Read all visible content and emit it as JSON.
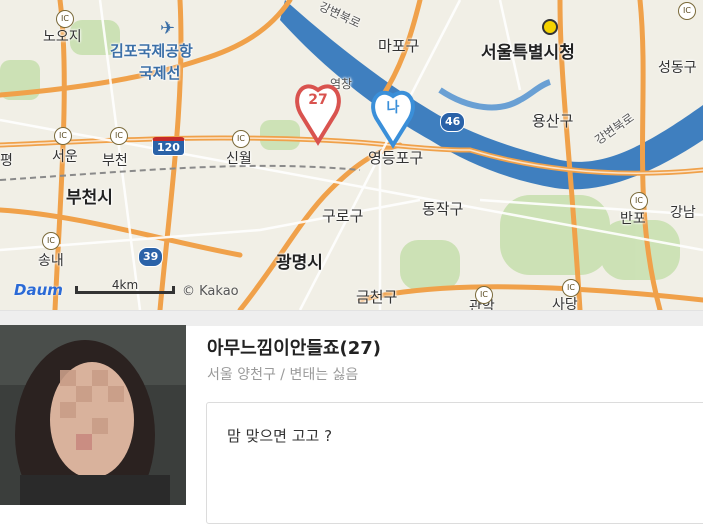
{
  "map": {
    "labels": {
      "seoul_city_hall": "서울특별시청",
      "gimpo_airport_1": "김포국제공항",
      "gimpo_airport_2": "국제선",
      "bucheon_si": "부천시",
      "gwangmyeong_si": "광명시",
      "mapo_gu": "마포구",
      "yongsan_gu": "용산구",
      "yeongdeungpo_gu": "영등포구",
      "dongjak_gu": "동작구",
      "guro_gu": "구로구",
      "geumcheon_gu": "금천구",
      "seongdong": "성동구",
      "gangnam": "강남",
      "banpo": "반포",
      "sadang": "사당",
      "gwanak": "관악",
      "noji": "노오지",
      "seoun": "서운",
      "bucheon": "부천",
      "sinwol": "신월",
      "songnae": "송내",
      "pyeong": "평",
      "gangbyeonbukro": "강변북로",
      "gangbyeonbukro2": "강변북로",
      "yeomchang": "염창",
      "ic": "IC"
    },
    "routes": [
      "120",
      "39",
      "46"
    ],
    "pins": {
      "user_age": "27",
      "me_label": "나"
    },
    "logo": "Daum",
    "scale_label": "4km",
    "copyright": "© Kakao"
  },
  "profile": {
    "name": "아무느낌이안들죠(27)",
    "location_line": "서울 양천구 / 변태는 싫음",
    "message": "맘 맞으면 고고 ?"
  },
  "colors": {
    "river": "#3f7fbf",
    "highway": "#f0a14a",
    "pin_user": "#d9534f",
    "pin_me": "#3a8fd9",
    "green": "#bcd9a4"
  },
  "icons": {
    "pin_user": "heart-pin-icon",
    "pin_me": "heart-pin-icon",
    "city_hall": "city-hall-marker-icon",
    "airport": "airplane-icon"
  }
}
